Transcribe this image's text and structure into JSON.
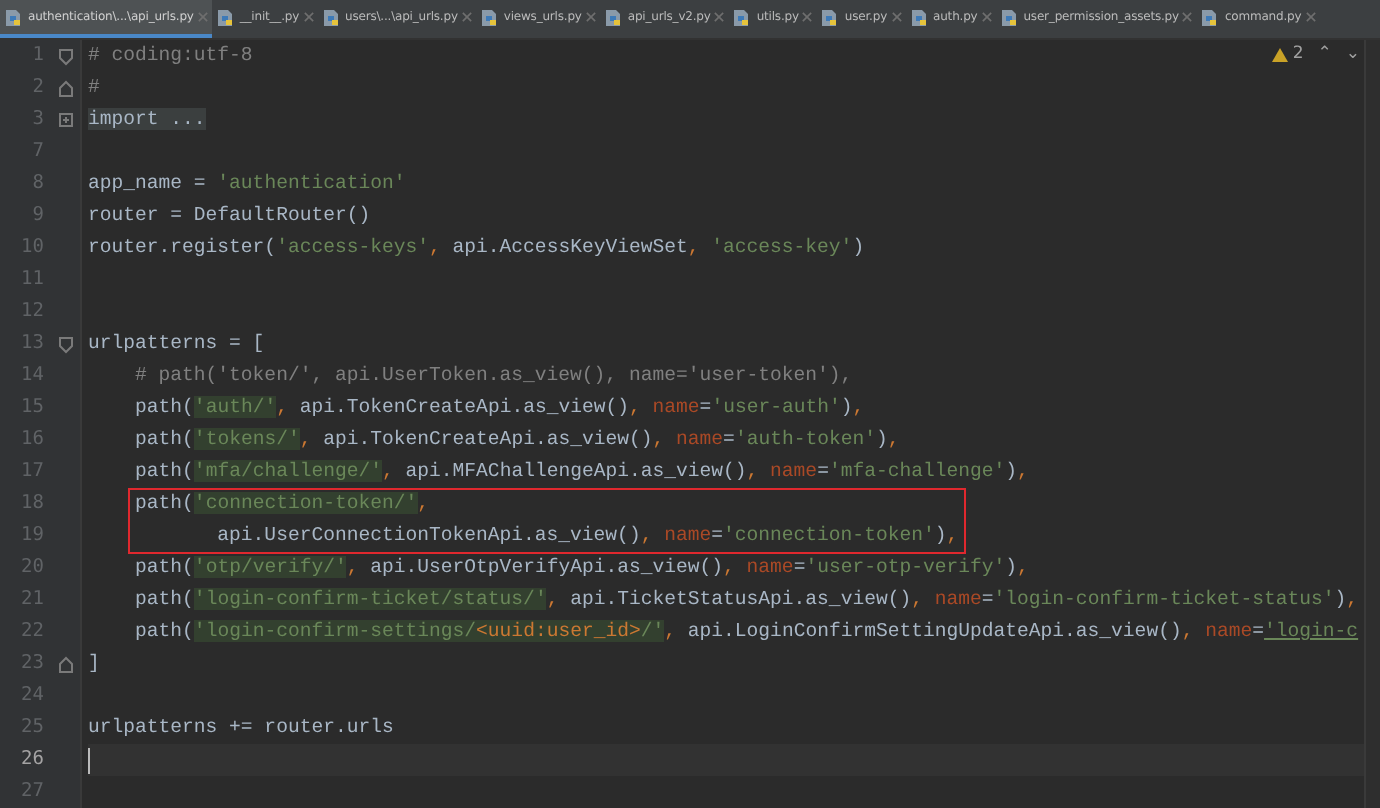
{
  "tabs": [
    {
      "label": "authentication\\...\\api_urls.py",
      "selected": true
    },
    {
      "label": "__init__.py",
      "selected": false
    },
    {
      "label": "users\\...\\api_urls.py",
      "selected": false
    },
    {
      "label": "views_urls.py",
      "selected": false
    },
    {
      "label": "api_urls_v2.py",
      "selected": false
    },
    {
      "label": "utils.py",
      "selected": false
    },
    {
      "label": "user.py",
      "selected": false
    },
    {
      "label": "auth.py",
      "selected": false
    },
    {
      "label": "user_permission_assets.py",
      "selected": false
    },
    {
      "label": "command.py",
      "selected": false
    }
  ],
  "inspections": {
    "warning_count": "2",
    "up": "⌃",
    "down": "⌄"
  },
  "lines": [
    {
      "number": "1",
      "kind": "opener",
      "current": false,
      "boxed": false,
      "tokens": [
        {
          "kind": "comment",
          "text": "# coding:utf-8"
        }
      ]
    },
    {
      "number": "2",
      "kind": "closer",
      "current": false,
      "boxed": false,
      "tokens": [
        {
          "kind": "comment",
          "text": "#"
        }
      ]
    },
    {
      "number": "3",
      "kind": "collapsed",
      "current": false,
      "boxed": false,
      "tokens": [
        {
          "kind": "folded",
          "text": "import ..."
        }
      ]
    },
    {
      "number": "7",
      "kind": "plain",
      "current": false,
      "boxed": false
    },
    {
      "number": "8",
      "kind": "plain",
      "current": false,
      "boxed": false,
      "tokens": [
        {
          "kind": "plain",
          "text": "app_name = "
        },
        {
          "kind": "string",
          "text": "'authentication'"
        }
      ]
    },
    {
      "number": "9",
      "kind": "plain",
      "current": false,
      "boxed": false,
      "tokens": [
        {
          "kind": "plain",
          "text": "router = DefaultRouter()"
        }
      ]
    },
    {
      "number": "10",
      "kind": "plain",
      "current": false,
      "boxed": false,
      "tokens": [
        {
          "kind": "plain",
          "text": "router.register("
        },
        {
          "kind": "string",
          "text": "'access-keys'"
        },
        {
          "kind": "punct",
          "text": ", "
        },
        {
          "kind": "plain",
          "text": "api.AccessKeyViewSet"
        },
        {
          "kind": "punct",
          "text": ", "
        },
        {
          "kind": "string",
          "text": "'access-key'"
        },
        {
          "kind": "plain",
          "text": ")"
        }
      ]
    },
    {
      "number": "11",
      "kind": "plain",
      "current": false,
      "boxed": false
    },
    {
      "number": "12",
      "kind": "plain",
      "current": false,
      "boxed": false
    },
    {
      "number": "13",
      "kind": "opener",
      "current": false,
      "boxed": false,
      "tokens": [
        {
          "kind": "plain",
          "text": "urlpatterns = ["
        }
      ]
    },
    {
      "number": "14",
      "kind": "plain",
      "current": false,
      "boxed": false,
      "tokens": [
        {
          "kind": "comment",
          "text": "    # path('token/', api.UserToken.as_view(), name='user-token'),"
        }
      ]
    },
    {
      "number": "15",
      "kind": "plain",
      "current": false,
      "boxed": false,
      "tokens": [
        {
          "kind": "plain",
          "text": "    path("
        },
        {
          "kind": "quote",
          "text": "'"
        },
        {
          "kind": "route",
          "text": "auth/"
        },
        {
          "kind": "quote",
          "text": "'"
        },
        {
          "kind": "punct",
          "text": ", "
        },
        {
          "kind": "plain",
          "text": "api.TokenCreateApi.as_view()"
        },
        {
          "kind": "punct",
          "text": ", "
        },
        {
          "kind": "kwarg",
          "text": "name"
        },
        {
          "kind": "plain",
          "text": "="
        },
        {
          "kind": "string",
          "text": "'user-auth'"
        },
        {
          "kind": "plain",
          "text": ")"
        },
        {
          "kind": "punct",
          "text": ","
        }
      ]
    },
    {
      "number": "16",
      "kind": "plain",
      "current": false,
      "boxed": false,
      "tokens": [
        {
          "kind": "plain",
          "text": "    path("
        },
        {
          "kind": "quote",
          "text": "'"
        },
        {
          "kind": "route",
          "text": "tokens/"
        },
        {
          "kind": "quote",
          "text": "'"
        },
        {
          "kind": "punct",
          "text": ", "
        },
        {
          "kind": "plain",
          "text": "api.TokenCreateApi.as_view()"
        },
        {
          "kind": "punct",
          "text": ", "
        },
        {
          "kind": "kwarg",
          "text": "name"
        },
        {
          "kind": "plain",
          "text": "="
        },
        {
          "kind": "string",
          "text": "'auth-token'"
        },
        {
          "kind": "plain",
          "text": ")"
        },
        {
          "kind": "punct",
          "text": ","
        }
      ]
    },
    {
      "number": "17",
      "kind": "plain",
      "current": false,
      "boxed": false,
      "tokens": [
        {
          "kind": "plain",
          "text": "    path("
        },
        {
          "kind": "quote",
          "text": "'"
        },
        {
          "kind": "route",
          "text": "mfa/challenge/"
        },
        {
          "kind": "quote",
          "text": "'"
        },
        {
          "kind": "punct",
          "text": ", "
        },
        {
          "kind": "plain",
          "text": "api.MFAChallengeApi.as_view()"
        },
        {
          "kind": "punct",
          "text": ", "
        },
        {
          "kind": "kwarg",
          "text": "name"
        },
        {
          "kind": "plain",
          "text": "="
        },
        {
          "kind": "string",
          "text": "'mfa-challenge'"
        },
        {
          "kind": "plain",
          "text": ")"
        },
        {
          "kind": "punct",
          "text": ","
        }
      ]
    },
    {
      "number": "18",
      "kind": "plain",
      "current": false,
      "boxed": true,
      "tokens": [
        {
          "kind": "plain",
          "text": "    path("
        },
        {
          "kind": "quote",
          "text": "'"
        },
        {
          "kind": "route",
          "text": "connection-token/"
        },
        {
          "kind": "quote",
          "text": "'"
        },
        {
          "kind": "punct",
          "text": ","
        }
      ]
    },
    {
      "number": "19",
      "kind": "plain",
      "current": false,
      "boxed": true,
      "tokens": [
        {
          "kind": "plain",
          "text": "           api.UserConnectionTokenApi.as_view()"
        },
        {
          "kind": "punct",
          "text": ", "
        },
        {
          "kind": "kwarg",
          "text": "name"
        },
        {
          "kind": "plain",
          "text": "="
        },
        {
          "kind": "string",
          "text": "'connection-token'"
        },
        {
          "kind": "plain",
          "text": ")"
        },
        {
          "kind": "punct",
          "text": ","
        }
      ]
    },
    {
      "number": "20",
      "kind": "plain",
      "current": false,
      "boxed": false,
      "tokens": [
        {
          "kind": "plain",
          "text": "    path("
        },
        {
          "kind": "quote",
          "text": "'"
        },
        {
          "kind": "route",
          "text": "otp/verify/"
        },
        {
          "kind": "quote",
          "text": "'"
        },
        {
          "kind": "punct",
          "text": ", "
        },
        {
          "kind": "plain",
          "text": "api.UserOtpVerifyApi.as_view()"
        },
        {
          "kind": "punct",
          "text": ", "
        },
        {
          "kind": "kwarg",
          "text": "name"
        },
        {
          "kind": "plain",
          "text": "="
        },
        {
          "kind": "string",
          "text": "'user-otp-verify'"
        },
        {
          "kind": "plain",
          "text": ")"
        },
        {
          "kind": "punct",
          "text": ","
        }
      ]
    },
    {
      "number": "21",
      "kind": "plain",
      "current": false,
      "boxed": false,
      "tokens": [
        {
          "kind": "plain",
          "text": "    path("
        },
        {
          "kind": "quote",
          "text": "'"
        },
        {
          "kind": "route",
          "text": "login-confirm-ticket/status/"
        },
        {
          "kind": "quote",
          "text": "'"
        },
        {
          "kind": "punct",
          "text": ", "
        },
        {
          "kind": "plain",
          "text": "api.TicketStatusApi.as_view()"
        },
        {
          "kind": "punct",
          "text": ", "
        },
        {
          "kind": "kwarg",
          "text": "name"
        },
        {
          "kind": "plain",
          "text": "="
        },
        {
          "kind": "string",
          "text": "'login-confirm-ticket-status'"
        },
        {
          "kind": "plain",
          "text": ")"
        },
        {
          "kind": "punct",
          "text": ","
        }
      ]
    },
    {
      "number": "22",
      "kind": "plain",
      "current": false,
      "boxed": false,
      "tokens": [
        {
          "kind": "plain",
          "text": "    path("
        },
        {
          "kind": "quote",
          "text": "'"
        },
        {
          "kind": "route",
          "text": "login-confirm-settings/"
        },
        {
          "kind": "converter",
          "text": "<uuid:user_id>"
        },
        {
          "kind": "route",
          "text": "/"
        },
        {
          "kind": "quote",
          "text": "'"
        },
        {
          "kind": "punct",
          "text": ", "
        },
        {
          "kind": "plain",
          "text": "api.LoginConfirmSettingUpdateApi.as_view()"
        },
        {
          "kind": "punct",
          "text": ", "
        },
        {
          "kind": "kwarg",
          "text": "name"
        },
        {
          "kind": "plain",
          "text": "="
        },
        {
          "kind": "linkstring",
          "text": "'login-c"
        }
      ]
    },
    {
      "number": "23",
      "kind": "closer",
      "current": false,
      "boxed": false,
      "tokens": [
        {
          "kind": "plain",
          "text": "]"
        }
      ]
    },
    {
      "number": "24",
      "kind": "plain",
      "current": false,
      "boxed": false
    },
    {
      "number": "25",
      "kind": "plain",
      "current": false,
      "boxed": false,
      "tokens": [
        {
          "kind": "plain",
          "text": "urlpatterns += router.urls"
        }
      ]
    },
    {
      "number": "26",
      "kind": "plain",
      "current": true,
      "boxed": false
    },
    {
      "number": "27",
      "kind": "plain",
      "current": false,
      "boxed": false
    }
  ]
}
